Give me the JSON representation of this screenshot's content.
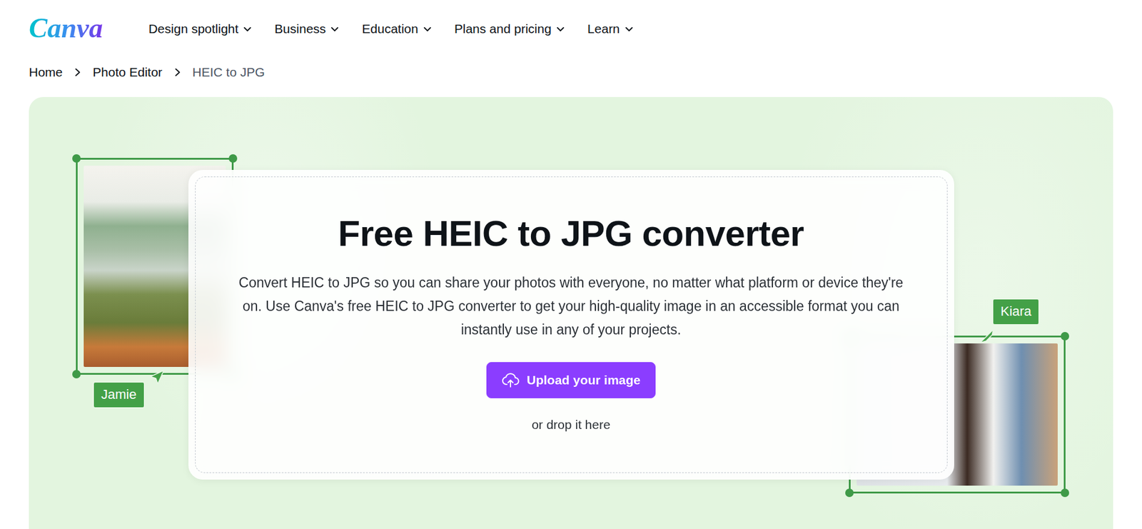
{
  "logo": "Canva",
  "nav": [
    {
      "label": "Design spotlight"
    },
    {
      "label": "Business"
    },
    {
      "label": "Education"
    },
    {
      "label": "Plans and pricing"
    },
    {
      "label": "Learn"
    }
  ],
  "breadcrumb": [
    {
      "label": "Home",
      "current": false
    },
    {
      "label": "Photo Editor",
      "current": false
    },
    {
      "label": "HEIC to JPG",
      "current": true
    }
  ],
  "hero": {
    "title": "Free HEIC to JPG converter",
    "description": "Convert HEIC to JPG so you can share your photos with everyone, no matter what platform or device they're on. Use Canva's free HEIC to JPG converter to get your high-quality image in an accessible format you can instantly use in any of your projects.",
    "upload_button": "Upload your image",
    "drop_hint": "or drop it here"
  },
  "collaborators": [
    {
      "name": "Jamie"
    },
    {
      "name": "Kiara"
    }
  ]
}
